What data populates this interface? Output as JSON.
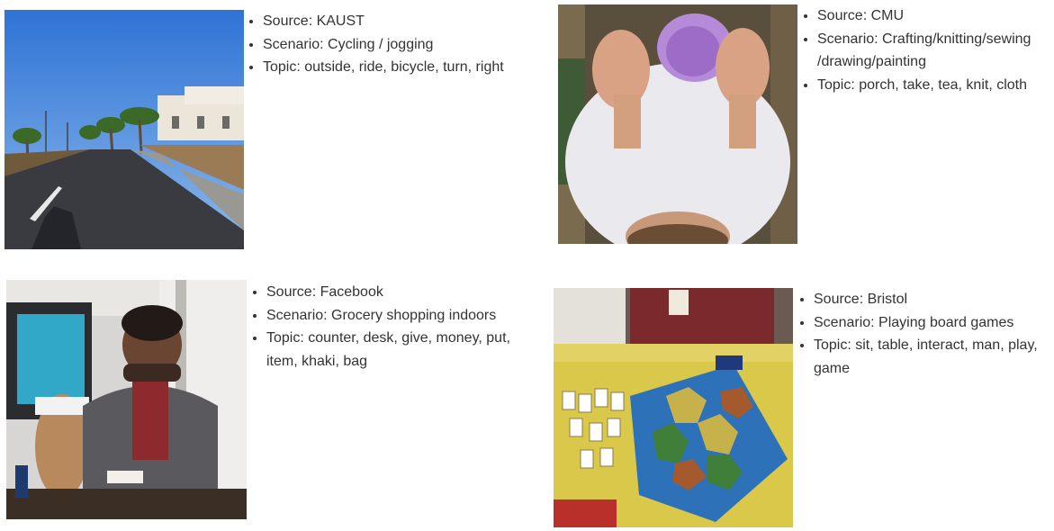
{
  "panels": [
    {
      "source_line": "Source: KAUST",
      "scenario_line": "Scenario: Cycling / jogging",
      "topic_line": "Topic: outside, ride, bicycle, turn, right"
    },
    {
      "source_line": "Source: CMU",
      "scenario_line": "Scenario: Crafting/knitting/sewing /drawing/painting",
      "topic_line": "Topic: porch, take, tea, knit, cloth"
    },
    {
      "source_line": "Source: Facebook",
      "scenario_line": "Scenario: Grocery shopping indoors",
      "topic_line": "Topic: counter, desk, give, money, put, item, khaki, bag"
    },
    {
      "source_line": "Source: Bristol",
      "scenario_line": "Scenario: Playing board games",
      "topic_line": "Topic: sit, table, interact, man, play, game"
    }
  ]
}
